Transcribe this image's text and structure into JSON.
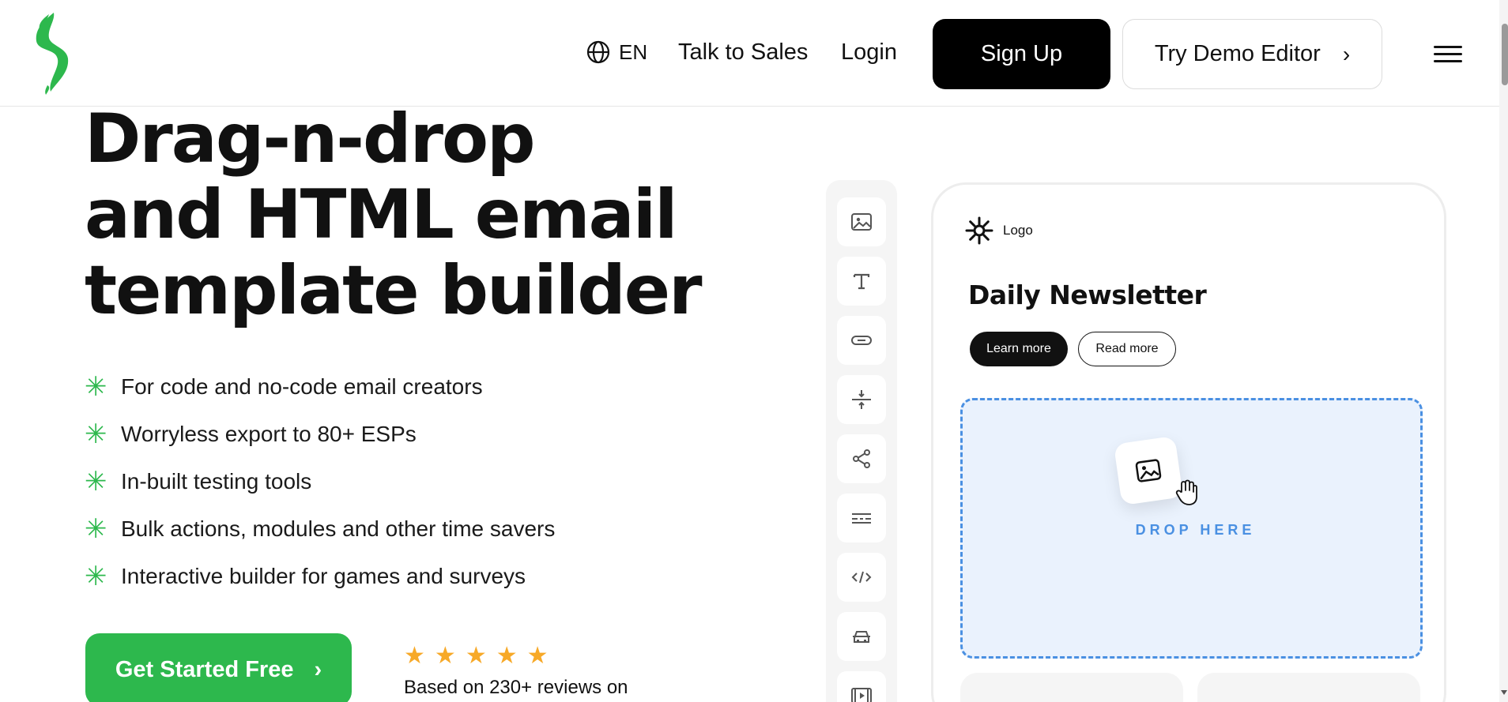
{
  "header": {
    "language": "EN",
    "talk_to_sales": "Talk to Sales",
    "login": "Login",
    "sign_up": "Sign Up",
    "try_demo": "Try Demo Editor",
    "try_demo_chevron": "›"
  },
  "hero": {
    "title_lines": [
      "Drag-n-drop",
      "and HTML email",
      "template builder"
    ],
    "feature_marker": "✳",
    "features": [
      "For code and no-code email creators",
      "Worryless export to 80+ ESPs",
      "In-built testing tools",
      "Bulk actions, modules and other time savers",
      "Interactive builder for games and surveys"
    ],
    "cta": "Get Started Free",
    "cta_chevron": "›",
    "rating_stars": 5,
    "star_glyph": "★",
    "reviews_text": "Based on 230+ reviews on"
  },
  "toolbar": {
    "tools": [
      "image-icon",
      "text-icon",
      "button-icon",
      "spacer-icon",
      "share-icon",
      "divider-icon",
      "code-icon",
      "amp-icon",
      "video-icon"
    ]
  },
  "preview": {
    "logo_label": "Logo",
    "title": "Daily Newsletter",
    "learn_more": "Learn more",
    "read_more": "Read more",
    "drop_label": "DROP HERE"
  },
  "colors": {
    "brand_green": "#2db84d",
    "drop_blue": "#4a90e2",
    "drop_bg": "#eaf2fd",
    "star_gold": "#f7a928"
  }
}
